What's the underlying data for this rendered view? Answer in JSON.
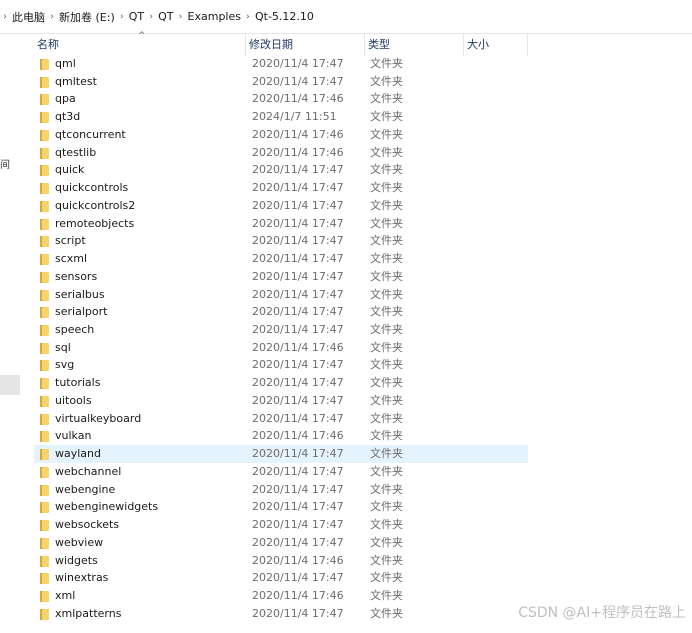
{
  "breadcrumb": {
    "items": [
      "此电脑",
      "新加卷 (E:)",
      "QT",
      "QT",
      "Examples",
      "Qt-5.12.10"
    ]
  },
  "left_pane": {
    "clipped_char": "间"
  },
  "columns": {
    "name": "名称",
    "date": "修改日期",
    "type": "类型",
    "size": "大小",
    "sort_arrow": "^"
  },
  "files": [
    {
      "name": "qml",
      "date": "2020/11/4 17:47",
      "type": "文件夹"
    },
    {
      "name": "qmltest",
      "date": "2020/11/4 17:47",
      "type": "文件夹"
    },
    {
      "name": "qpa",
      "date": "2020/11/4 17:46",
      "type": "文件夹"
    },
    {
      "name": "qt3d",
      "date": "2024/1/7 11:51",
      "type": "文件夹"
    },
    {
      "name": "qtconcurrent",
      "date": "2020/11/4 17:46",
      "type": "文件夹"
    },
    {
      "name": "qtestlib",
      "date": "2020/11/4 17:46",
      "type": "文件夹"
    },
    {
      "name": "quick",
      "date": "2020/11/4 17:47",
      "type": "文件夹"
    },
    {
      "name": "quickcontrols",
      "date": "2020/11/4 17:47",
      "type": "文件夹"
    },
    {
      "name": "quickcontrols2",
      "date": "2020/11/4 17:47",
      "type": "文件夹"
    },
    {
      "name": "remoteobjects",
      "date": "2020/11/4 17:47",
      "type": "文件夹"
    },
    {
      "name": "script",
      "date": "2020/11/4 17:47",
      "type": "文件夹"
    },
    {
      "name": "scxml",
      "date": "2020/11/4 17:47",
      "type": "文件夹"
    },
    {
      "name": "sensors",
      "date": "2020/11/4 17:47",
      "type": "文件夹"
    },
    {
      "name": "serialbus",
      "date": "2020/11/4 17:47",
      "type": "文件夹"
    },
    {
      "name": "serialport",
      "date": "2020/11/4 17:47",
      "type": "文件夹"
    },
    {
      "name": "speech",
      "date": "2020/11/4 17:47",
      "type": "文件夹"
    },
    {
      "name": "sql",
      "date": "2020/11/4 17:46",
      "type": "文件夹"
    },
    {
      "name": "svg",
      "date": "2020/11/4 17:47",
      "type": "文件夹"
    },
    {
      "name": "tutorials",
      "date": "2020/11/4 17:47",
      "type": "文件夹"
    },
    {
      "name": "uitools",
      "date": "2020/11/4 17:47",
      "type": "文件夹"
    },
    {
      "name": "virtualkeyboard",
      "date": "2020/11/4 17:47",
      "type": "文件夹"
    },
    {
      "name": "vulkan",
      "date": "2020/11/4 17:46",
      "type": "文件夹"
    },
    {
      "name": "wayland",
      "date": "2020/11/4 17:47",
      "type": "文件夹",
      "highlighted": true
    },
    {
      "name": "webchannel",
      "date": "2020/11/4 17:47",
      "type": "文件夹"
    },
    {
      "name": "webengine",
      "date": "2020/11/4 17:47",
      "type": "文件夹"
    },
    {
      "name": "webenginewidgets",
      "date": "2020/11/4 17:47",
      "type": "文件夹"
    },
    {
      "name": "websockets",
      "date": "2020/11/4 17:47",
      "type": "文件夹"
    },
    {
      "name": "webview",
      "date": "2020/11/4 17:47",
      "type": "文件夹"
    },
    {
      "name": "widgets",
      "date": "2020/11/4 17:46",
      "type": "文件夹"
    },
    {
      "name": "winextras",
      "date": "2020/11/4 17:47",
      "type": "文件夹"
    },
    {
      "name": "xml",
      "date": "2020/11/4 17:46",
      "type": "文件夹"
    },
    {
      "name": "xmlpatterns",
      "date": "2020/11/4 17:47",
      "type": "文件夹"
    }
  ],
  "watermark": "CSDN @AI+程序员在路上",
  "colors": {
    "highlight_row": "#e5f3ff",
    "folder_yellow": "#f6d46d",
    "header_text": "#1f3a66",
    "meta_text": "#6d6d6d"
  }
}
